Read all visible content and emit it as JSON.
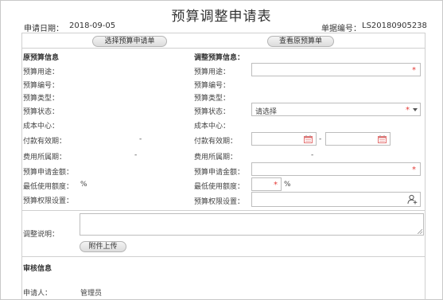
{
  "title": "预算调整申请表",
  "header": {
    "date_label": "申请日期：",
    "date_value": "2018-09-05",
    "doc_label": "单据编号：",
    "doc_value": "LS20180905238"
  },
  "buttons": {
    "select_budget": "选择预算申请单",
    "view_budget": "查看原预算单",
    "attachment": "附件上传"
  },
  "left": {
    "heading": "原预算信息",
    "fields": [
      "预算用途：",
      "预算编号：",
      "预算类型：",
      "预算状态：",
      "成本中心：",
      "付款有效期：",
      "费用所属期：",
      "预算申请金额：",
      "最低使用额度：",
      "预算权限设置："
    ],
    "payment_dash": "-",
    "period_dash": "-",
    "percent": "%"
  },
  "right": {
    "heading": "调整预算信息：",
    "fields": [
      "预算用途：",
      "预算编号：",
      "预算类型：",
      "预算状态：",
      "成本中心：",
      "付款有效期：",
      "费用所属期：",
      "预算申请金额：",
      "最低使用额度：",
      "预算权限设置："
    ],
    "status_placeholder": "请选择",
    "range_separator": "-",
    "period_dash": "-",
    "percent": "%"
  },
  "remarks_label": "调整说明：",
  "approval": {
    "heading": "审核信息",
    "applicant_label": "申请人：",
    "applicant_value": "管理员"
  },
  "colors": {
    "required": "#e53935",
    "calendar": "#e57373"
  },
  "icons": [
    "calendar-icon",
    "user-add-icon",
    "dropdown-caret-icon",
    "resize-grip-icon"
  ]
}
